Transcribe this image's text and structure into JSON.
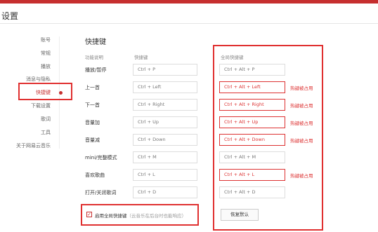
{
  "window": {
    "title": "设置"
  },
  "nav": {
    "items": [
      "账号",
      "常规",
      "播放",
      "消息与隐私",
      "快捷键",
      "下载设置",
      "歌词",
      "工具",
      "关于网易云音乐"
    ],
    "active_index": 4
  },
  "section": {
    "title": "快捷键",
    "col_function": "功能说明",
    "col_local": "快捷键",
    "col_global": "全局快捷键"
  },
  "shortcuts": [
    {
      "label": "播放/暂停",
      "local": "Ctrl + P",
      "global": "Ctrl + Alt + P",
      "conflict": false,
      "note": ""
    },
    {
      "label": "上一首",
      "local": "Ctrl + Left",
      "global": "Ctrl + Alt + Left",
      "conflict": true,
      "note": "热键被占用"
    },
    {
      "label": "下一首",
      "local": "Ctrl + Right",
      "global": "Ctrl + Alt + Right",
      "conflict": true,
      "note": "热键被占用"
    },
    {
      "label": "音量加",
      "local": "Ctrl + Up",
      "global": "Ctrl + Alt + Up",
      "conflict": true,
      "note": "热键被占用"
    },
    {
      "label": "音量减",
      "local": "Ctrl + Down",
      "global": "Ctrl + Alt + Down",
      "conflict": true,
      "note": "热键被占用"
    },
    {
      "label": "mini/完整模式",
      "local": "Ctrl + M",
      "global": "Ctrl + Alt + M",
      "conflict": false,
      "note": ""
    },
    {
      "label": "喜欢歌曲",
      "local": "Ctrl + L",
      "global": "Ctrl + Alt + L",
      "conflict": true,
      "note": "热键被占用"
    },
    {
      "label": "打开/关闭歌词",
      "local": "Ctrl + D",
      "global": "Ctrl + Alt + D",
      "conflict": false,
      "note": ""
    }
  ],
  "options": {
    "enable_global_label": "启用全局快捷键",
    "enable_global_hint": "（云音乐在后台时也能响应）",
    "enable_global_checked": "✓",
    "reset_label": "恢复默认"
  },
  "colors": {
    "accent": "#c62f2f",
    "annotation_red": "#e03030"
  }
}
